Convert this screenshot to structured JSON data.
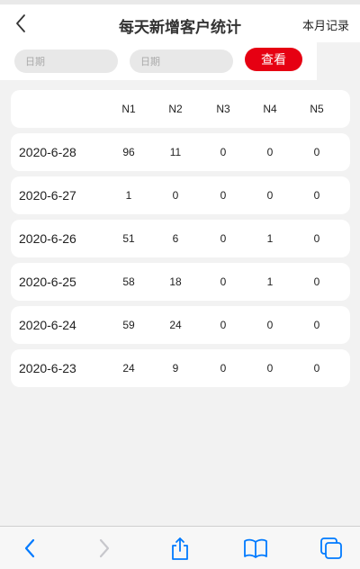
{
  "header": {
    "title": "每天新增客户统计",
    "monthly_link": "本月记录"
  },
  "filters": {
    "start_placeholder": "日期",
    "end_placeholder": "日期",
    "view_label": "查看"
  },
  "table": {
    "columns": [
      "N1",
      "N2",
      "N3",
      "N4",
      "N5"
    ],
    "rows": [
      {
        "date": "2020-6-28",
        "values": [
          "96",
          "11",
          "0",
          "0",
          "0"
        ]
      },
      {
        "date": "2020-6-27",
        "values": [
          "1",
          "0",
          "0",
          "0",
          "0"
        ]
      },
      {
        "date": "2020-6-26",
        "values": [
          "51",
          "6",
          "0",
          "1",
          "0"
        ]
      },
      {
        "date": "2020-6-25",
        "values": [
          "58",
          "18",
          "0",
          "1",
          "0"
        ]
      },
      {
        "date": "2020-6-24",
        "values": [
          "59",
          "24",
          "0",
          "0",
          "0"
        ]
      },
      {
        "date": "2020-6-23",
        "values": [
          "24",
          "9",
          "0",
          "0",
          "0"
        ]
      }
    ]
  },
  "toolbar": {
    "icons": [
      "back-icon",
      "forward-icon",
      "share-icon",
      "bookmarks-icon",
      "tabs-icon"
    ],
    "accent_color": "#007aff",
    "disabled_color": "#c7c7cc"
  },
  "colors": {
    "primary_button": "#e60012",
    "background": "#f2f2f2"
  }
}
